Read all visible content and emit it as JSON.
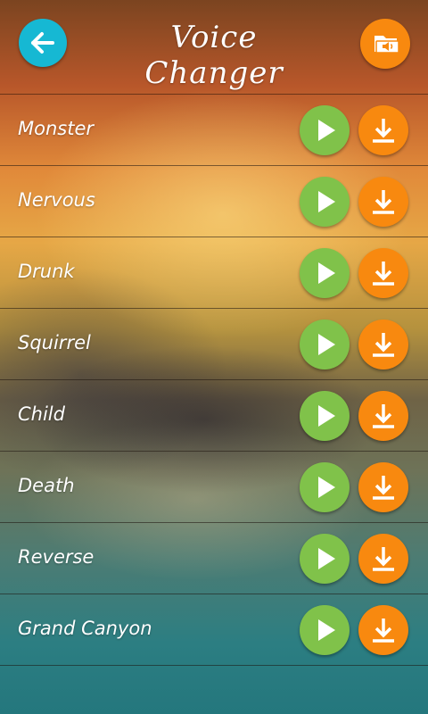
{
  "header": {
    "title": "Voice Changer",
    "back_icon": "arrow-left-icon",
    "files_icon": "audio-folder-icon"
  },
  "colors": {
    "back_button": "#16b8d3",
    "play_button": "#80c24a",
    "download_button": "#f8890f",
    "files_button": "#f8890f"
  },
  "effects": [
    {
      "label": "Monster"
    },
    {
      "label": "Nervous"
    },
    {
      "label": "Drunk"
    },
    {
      "label": "Squirrel"
    },
    {
      "label": "Child"
    },
    {
      "label": "Death"
    },
    {
      "label": "Reverse"
    },
    {
      "label": "Grand Canyon"
    }
  ]
}
